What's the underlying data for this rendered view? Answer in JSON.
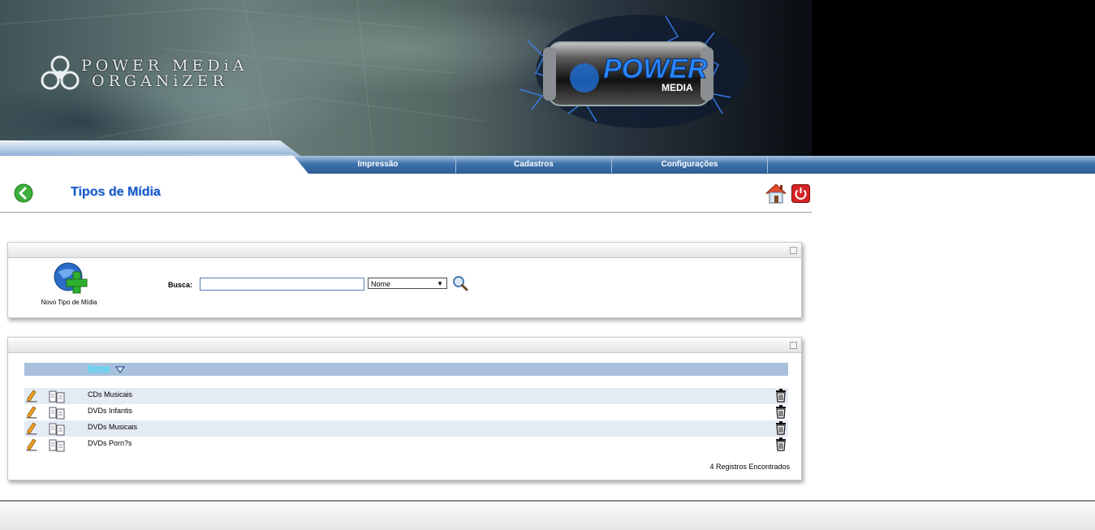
{
  "header": {
    "logo_line1": "POWER MEDiA",
    "logo_line2": "ORGANiZER",
    "can_brand": "POWER",
    "can_sub": "MEDIA"
  },
  "nav": {
    "items": [
      {
        "label": "Impressão"
      },
      {
        "label": "Cadastros"
      },
      {
        "label": "Configurações"
      }
    ]
  },
  "page": {
    "title": "Tipos de Mídia"
  },
  "search_panel": {
    "new_label": "Novo Tipo de Mídia",
    "busca_label": "Busca:",
    "busca_value": "",
    "select_value": "Nome"
  },
  "table": {
    "header_nome": "Nome",
    "rows": [
      {
        "name": "CDs Musicais"
      },
      {
        "name": "DVDs Infantis"
      },
      {
        "name": "DVDs Musicais"
      },
      {
        "name": "DVDs Porn?s"
      }
    ],
    "count_text": "4 Registros Encontrados"
  },
  "colors": {
    "nav_blue": "#3a6ea5",
    "title_blue": "#1558c8",
    "table_header": "#a9c1dc",
    "row_shade": "#e4ebf5"
  }
}
